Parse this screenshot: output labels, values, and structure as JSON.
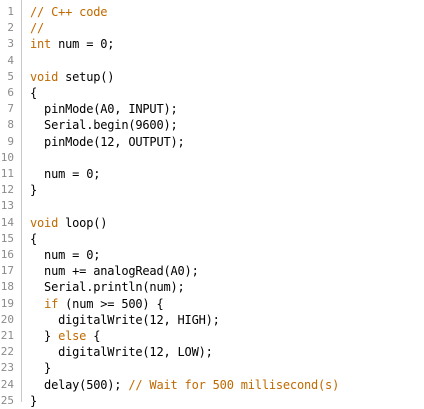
{
  "editor": {
    "theme": {
      "comment": "#95a5a6",
      "keyword": "#c06a00",
      "text": "#000000",
      "line_number": "#8a8a8a",
      "gutter_border": "#c8c8c8"
    },
    "lines": [
      {
        "n": "1",
        "tokens": [
          {
            "t": "// C++ code",
            "k": "keyword"
          }
        ]
      },
      {
        "n": "2",
        "tokens": [
          {
            "t": "//",
            "k": "keyword"
          }
        ]
      },
      {
        "n": "3",
        "tokens": [
          {
            "t": "int",
            "k": "keyword"
          },
          {
            "t": " num = 0;",
            "k": "text"
          }
        ]
      },
      {
        "n": "4",
        "tokens": []
      },
      {
        "n": "5",
        "tokens": [
          {
            "t": "void",
            "k": "keyword"
          },
          {
            "t": " setup()",
            "k": "text"
          }
        ]
      },
      {
        "n": "6",
        "tokens": [
          {
            "t": "{",
            "k": "text"
          }
        ]
      },
      {
        "n": "7",
        "tokens": [
          {
            "t": "  pinMode(A0, INPUT);",
            "k": "text"
          }
        ]
      },
      {
        "n": "8",
        "tokens": [
          {
            "t": "  Serial.begin(9600);",
            "k": "text"
          }
        ]
      },
      {
        "n": "9",
        "tokens": [
          {
            "t": "  pinMode(12, OUTPUT);",
            "k": "text"
          }
        ]
      },
      {
        "n": "10",
        "tokens": []
      },
      {
        "n": "11",
        "tokens": [
          {
            "t": "  num = 0;",
            "k": "text"
          }
        ]
      },
      {
        "n": "12",
        "tokens": [
          {
            "t": "}",
            "k": "text"
          }
        ]
      },
      {
        "n": "13",
        "tokens": []
      },
      {
        "n": "14",
        "tokens": [
          {
            "t": "void",
            "k": "keyword"
          },
          {
            "t": " loop()",
            "k": "text"
          }
        ]
      },
      {
        "n": "15",
        "tokens": [
          {
            "t": "{",
            "k": "text"
          }
        ]
      },
      {
        "n": "16",
        "tokens": [
          {
            "t": "  num = 0;",
            "k": "text"
          }
        ]
      },
      {
        "n": "17",
        "tokens": [
          {
            "t": "  num += analogRead(A0);",
            "k": "text"
          }
        ]
      },
      {
        "n": "18",
        "tokens": [
          {
            "t": "  Serial.println(num);",
            "k": "text"
          }
        ]
      },
      {
        "n": "19",
        "tokens": [
          {
            "t": "  ",
            "k": "text"
          },
          {
            "t": "if",
            "k": "keyword"
          },
          {
            "t": " (num >= 500) {",
            "k": "text"
          }
        ]
      },
      {
        "n": "20",
        "tokens": [
          {
            "t": "    digitalWrite(12, HIGH);",
            "k": "text"
          }
        ]
      },
      {
        "n": "21",
        "tokens": [
          {
            "t": "  } ",
            "k": "text"
          },
          {
            "t": "else",
            "k": "keyword"
          },
          {
            "t": " {",
            "k": "text"
          }
        ]
      },
      {
        "n": "22",
        "tokens": [
          {
            "t": "    digitalWrite(12, LOW);",
            "k": "text"
          }
        ]
      },
      {
        "n": "23",
        "tokens": [
          {
            "t": "  }",
            "k": "text"
          }
        ]
      },
      {
        "n": "24",
        "tokens": [
          {
            "t": "  delay(500); ",
            "k": "text"
          },
          {
            "t": "// Wait for 500 millisecond(s)",
            "k": "keyword"
          }
        ]
      },
      {
        "n": "25",
        "tokens": [
          {
            "t": "}",
            "k": "text"
          }
        ]
      }
    ]
  }
}
